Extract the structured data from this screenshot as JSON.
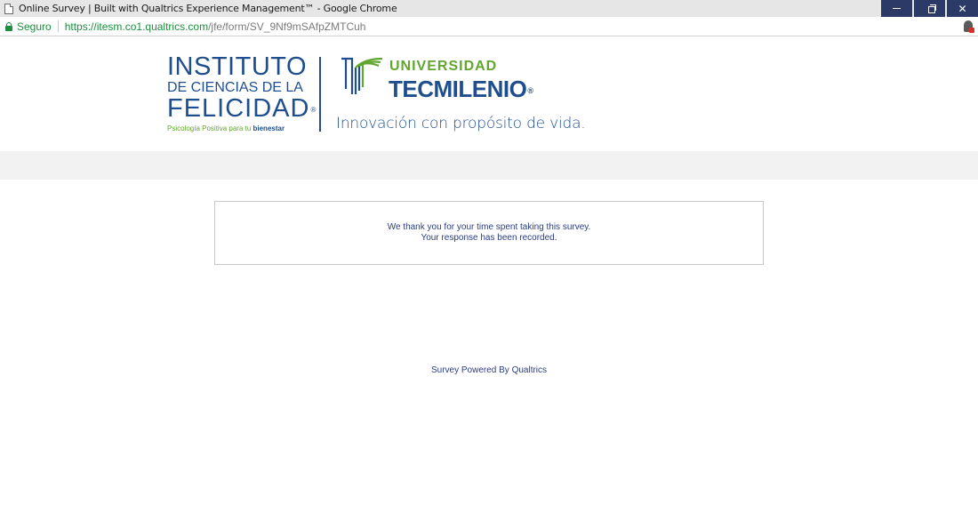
{
  "window": {
    "title": "Online Survey | Built with Qualtrics Experience Management™ - Google Chrome",
    "controls": {
      "minimize": "—",
      "restore": "❐",
      "close": "✕"
    }
  },
  "address_bar": {
    "secure_label": "Seguro",
    "url_host": "https://itesm.co1.qualtrics.com",
    "url_path": "/jfe/form/SV_9Nf9mSAfpZMTCuh"
  },
  "logo": {
    "icf_line1": "INSTITUTO",
    "icf_line2": "DE CIENCIAS DE LA",
    "icf_line3": "FELICIDAD",
    "icf_registered": "®",
    "icf_tagline": "Psicología Positiva para tu ",
    "icf_tagline_bold": "bienestar",
    "univ_label": "UNIVERSIDAD",
    "tec_label": "TECMILENIO",
    "tec_registered": "®",
    "slogan": "Innovación con propósito de vida."
  },
  "message": {
    "line1": "We thank you for your time spent taking this survey.",
    "line2": "Your response has been recorded."
  },
  "footer": {
    "powered_by": "Survey Powered By Qualtrics"
  },
  "colors": {
    "brand_blue": "#1f4e8f",
    "brand_green": "#62a62f",
    "text_blue": "#2b3d82",
    "window_control": "#2b3a67",
    "secure_green": "#1e8e3e"
  }
}
